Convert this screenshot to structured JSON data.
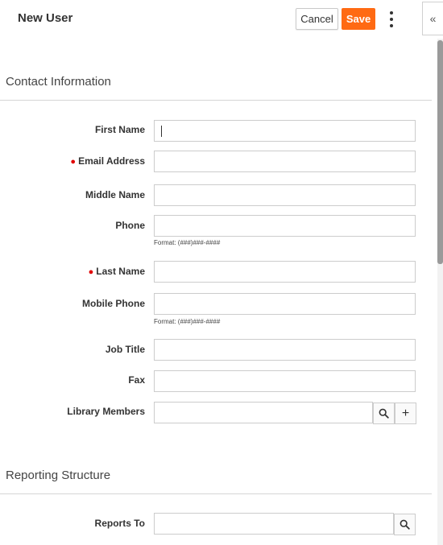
{
  "header": {
    "title": "New User",
    "cancel_label": "Cancel",
    "save_label": "Save",
    "collapse_glyph": "«",
    "accent_color": "#ff6a13"
  },
  "sections": {
    "contact": "Contact Information",
    "reporting": "Reporting Structure"
  },
  "fields": {
    "first_name": {
      "label": "First Name",
      "value": ""
    },
    "email": {
      "label": "Email Address",
      "required": true,
      "value": ""
    },
    "middle_name": {
      "label": "Middle Name",
      "value": ""
    },
    "phone": {
      "label": "Phone",
      "value": "",
      "hint": "Format: (###)###-####"
    },
    "last_name": {
      "label": "Last Name",
      "required": true,
      "value": ""
    },
    "mobile_phone": {
      "label": "Mobile Phone",
      "value": "",
      "hint": "Format: (###)###-####"
    },
    "job_title": {
      "label": "Job Title",
      "value": ""
    },
    "fax": {
      "label": "Fax",
      "value": ""
    },
    "library_members": {
      "label": "Library Members",
      "value": ""
    },
    "reports_to": {
      "label": "Reports To",
      "value": ""
    }
  },
  "icons": {
    "required": "required-dot-icon",
    "search": "search-icon",
    "add": "plus-icon",
    "more": "more-vertical-icon",
    "collapse": "double-chevron-left-icon"
  },
  "required_color": "#e00000"
}
